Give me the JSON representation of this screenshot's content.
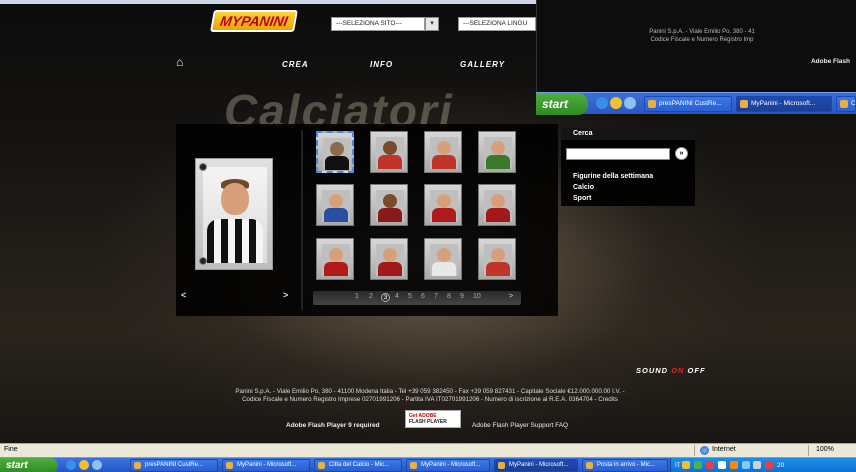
{
  "header": {
    "logo_text": "MYPANINI",
    "site_select": "---SELEZIONA SITO---",
    "lang_select": "---SELEZIONA LINGU",
    "nav": [
      "CREA",
      "INFO",
      "GALLERY"
    ]
  },
  "hero_title": "Calciatori",
  "card_nav": {
    "prev": "<",
    "next": ">"
  },
  "pager": {
    "pages": [
      "1",
      "2",
      "3",
      "4",
      "5",
      "6",
      "7",
      "8",
      "9",
      "10"
    ],
    "current": "3",
    "next": ">"
  },
  "menu": {
    "search_label": "Cerca",
    "search_go": "»",
    "items": [
      "Figurine della settimana",
      "Calcio",
      "Sport"
    ]
  },
  "sound": {
    "label": "SOUND",
    "on": "ON",
    "off": "OFF"
  },
  "footer": {
    "line1": "Panini S.p.A. - Viale Emilio Po, 380 - 41100 Modena Italia - Tel +39 059 382450 - Fax +39 059 827431 - Capitale Sociale €12.000.000.00 I.V. -",
    "line2": "Codice Fiscale e Numero Registro Imprese 02701991206 - Partita IVA IT02701991206 - Numero di iscrizione al R.E.A. 0364704 - Credits",
    "flash_required": "Adobe Flash Player 9 required",
    "get_flash_a": "Get ADOBE",
    "get_flash_b": "FLASH PLAYER",
    "flash_faq": "Adobe Flash Player Support FAQ"
  },
  "win2": {
    "footer_line1": "Panini S.p.A. - Viale Emilio Po, 380 - 41",
    "footer_line2": "Codice Fiscale e Numero Registro Imp",
    "flash": "Adobe Flash",
    "start": "start",
    "tasks": [
      "presPANINI CustRe...",
      "MyPanini - Microsoft...",
      "C"
    ]
  },
  "status": {
    "left": "Fine",
    "zone": "Internet",
    "zoom": "100%"
  },
  "taskbar": {
    "start": "start",
    "items": [
      "presPANINI CustRe...",
      "MyPanini - Microsoft...",
      "Citta del Calcio - Mic...",
      "MyPanini - Microsoft...",
      "MyPanini - Microsoft...",
      "Posta in arrivo - Mic..."
    ],
    "tray_text": "IT",
    "clock": "20"
  },
  "colors": {
    "accent_red": "#e0262a",
    "xp_blue": "#2356c8",
    "start_green": "#3a9a2e"
  }
}
